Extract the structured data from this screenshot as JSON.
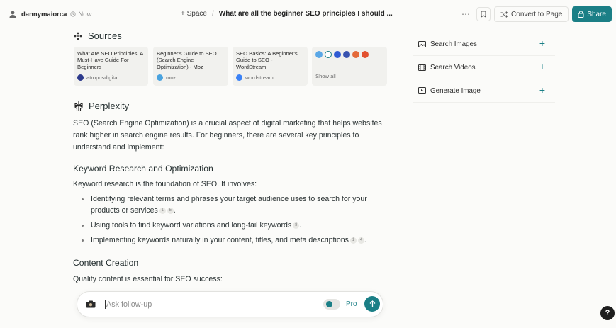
{
  "topbar": {
    "username": "dannymaiorca",
    "time": "Now",
    "space_label": "+ Space",
    "separator": "/",
    "thread_title": "What are all the beginner SEO principles I should ...",
    "more": "⋯",
    "convert_label": "Convert to Page",
    "share_label": "Share"
  },
  "sources": {
    "heading": "Sources",
    "cards": [
      {
        "title": "What Are SEO Principles: A Must-Have Guide For Beginners",
        "domain": "atroposdigital",
        "favicon_color": "#2d3a8c"
      },
      {
        "title": "Beginner's Guide to SEO (Search Engine Optimization) - Moz",
        "domain": "moz",
        "favicon_color": "#4aa3df"
      },
      {
        "title": "SEO Basics: A Beginner's Guide to SEO - WordStream",
        "domain": "wordstream",
        "favicon_color": "#3b82f6"
      }
    ],
    "show_all": {
      "label": "Show all",
      "icon_colors": [
        "#5aa7e6",
        "#1b7f86",
        "#2f5bd3",
        "#3953b0",
        "#e46a3a",
        "#e2512f"
      ]
    }
  },
  "answer": {
    "heading": "Perplexity",
    "intro": "SEO (Search Engine Optimization) is a crucial aspect of digital marketing that helps websites rank higher in search engine results. For beginners, there are several key principles to understand and implement:",
    "section1_title": "Keyword Research and Optimization",
    "section1_intro": "Keyword research is the foundation of SEO. It involves:",
    "bullets": [
      {
        "text": "Identifying relevant terms and phrases your target audience uses to search for your products or services",
        "cites": [
          "1",
          "5"
        ]
      },
      {
        "text": "Using tools to find keyword variations and long-tail keywords",
        "cites": [
          "8"
        ]
      },
      {
        "text": "Implementing keywords naturally in your content, titles, and meta descriptions",
        "cites": [
          "1",
          "4"
        ]
      }
    ],
    "section2_title": "Content Creation",
    "section2_intro": "Quality content is essential for SEO success:"
  },
  "right_panel": {
    "items": [
      {
        "label": "Search Images",
        "icon": "image-icon"
      },
      {
        "label": "Search Videos",
        "icon": "video-icon"
      },
      {
        "label": "Generate Image",
        "icon": "generate-image-icon"
      }
    ]
  },
  "followup": {
    "placeholder": "Ask follow-up",
    "pro_label": "Pro"
  },
  "help_label": "?",
  "colors": {
    "accent": "#1b7f86",
    "background": "#fbfbf9"
  }
}
